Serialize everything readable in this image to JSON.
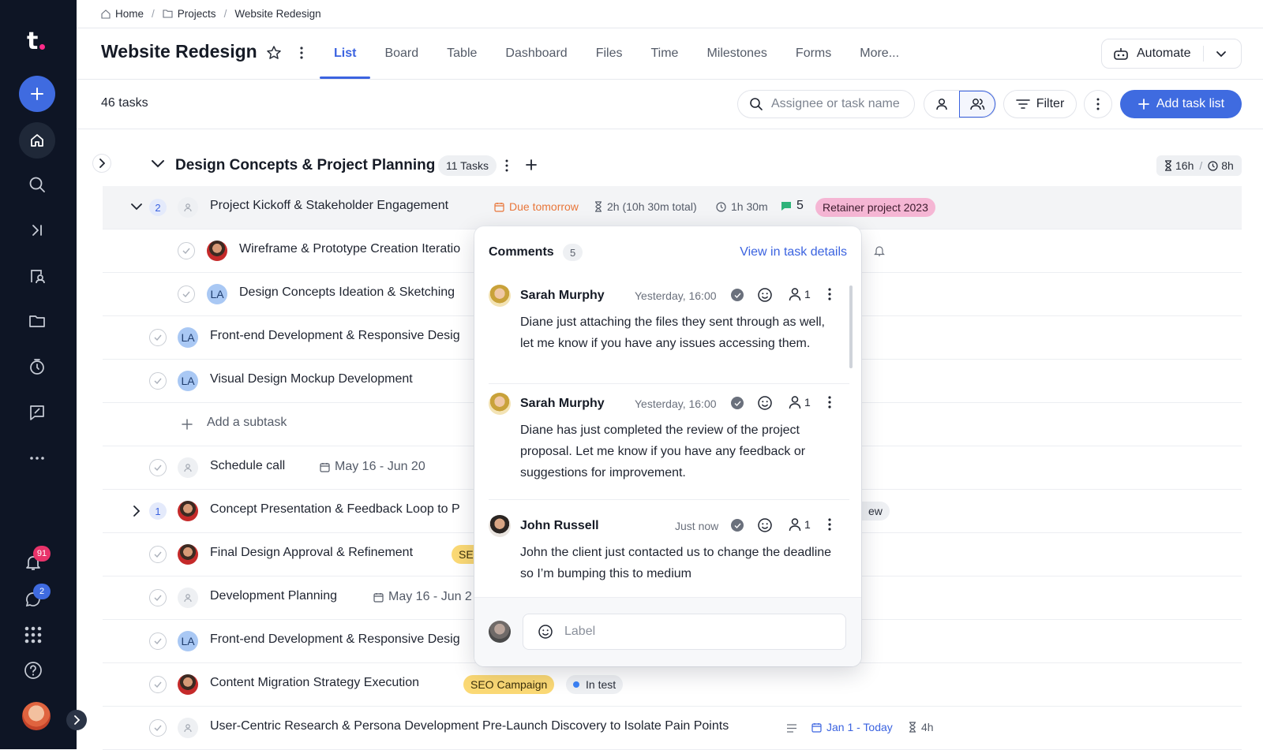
{
  "sidebar": {
    "logo": "t",
    "notifications_badge": "91",
    "chat_badge": "2"
  },
  "breadcrumb": [
    "Home",
    "Projects",
    "Website Redesign"
  ],
  "project": {
    "title": "Website Redesign",
    "tabs": [
      "List",
      "Board",
      "Table",
      "Dashboard",
      "Files",
      "Time",
      "Milestones",
      "Forms",
      "More..."
    ],
    "active_tab": "List",
    "automate_label": "Automate"
  },
  "toolbar": {
    "task_count": "46 tasks",
    "search_placeholder": "Assignee or task name",
    "filter_label": "Filter",
    "add_task_list_label": "Add task list"
  },
  "group": {
    "title": "Design Concepts & Project Planning",
    "count": "11 Tasks",
    "estimate": "16h",
    "logged": "8h"
  },
  "tasks": {
    "kickoff": {
      "subtasks": "2",
      "name": "Project Kickoff & Stakeholder Engagement",
      "due": "Due tomorrow",
      "estimate": "2h (10h 30m total)",
      "logged": "1h 30m",
      "comments": "5",
      "tag": "Retainer project 2023"
    },
    "wireframe": {
      "name": "Wireframe & Prototype Creation Iteratio"
    },
    "ideation": {
      "avatar": "LA",
      "name": "Design Concepts Ideation & Sketching"
    },
    "frontend1": {
      "avatar": "LA",
      "name": "Front-end Development & Responsive Desig"
    },
    "mockup": {
      "avatar": "LA",
      "name": "Visual Design Mockup Development"
    },
    "add_subtask": "Add a subtask",
    "schedule": {
      "name": "Schedule call",
      "dates": "May 16 - Jun 20"
    },
    "concept": {
      "subtasks": "1",
      "name": "Concept Presentation & Feedback Loop to P",
      "pill_tail": "ew"
    },
    "approval": {
      "name": "Final Design Approval & Refinement",
      "tag": "SE"
    },
    "devplan": {
      "name": "Development Planning",
      "dates": "May 16 - Jun 2"
    },
    "frontend2": {
      "avatar": "LA",
      "name": "Front-end Development & Responsive Desig"
    },
    "migration": {
      "name": "Content Migration Strategy Execution",
      "tag": "SEO Campaign",
      "status": "In test"
    },
    "research": {
      "name": "User-Centric Research & Persona Development Pre-Launch Discovery to Isolate Pain Points",
      "dates": "Jan 1 - Today",
      "estimate": "4h"
    }
  },
  "comments_popup": {
    "title": "Comments",
    "count": "5",
    "view_link": "View in task details",
    "items": [
      {
        "author": "Sarah Murphy",
        "time": "Yesterday, 16:00",
        "assignees": "1",
        "text": "Diane just attaching the files they sent through as well, let me know if you have any issues accessing them."
      },
      {
        "author": "Sarah Murphy",
        "time": "Yesterday, 16:00",
        "assignees": "1",
        "text": "Diane has just completed the review of the project proposal. Let me know if you have any feedback or suggestions for improvement."
      },
      {
        "author": "John Russell",
        "time": "Just now",
        "assignees": "1",
        "text": "John the client just contacted us to change the deadline so I’m bumping this to medium"
      }
    ],
    "input_placeholder": "Label"
  },
  "colors": {
    "accent": "#3f6be0",
    "sidebar_bg": "#0e1525",
    "due_orange": "#e8763a",
    "retainer_tag": "#f5b6d4",
    "seo_tag": "#fbd975",
    "date_blue": "#3b63e0"
  }
}
